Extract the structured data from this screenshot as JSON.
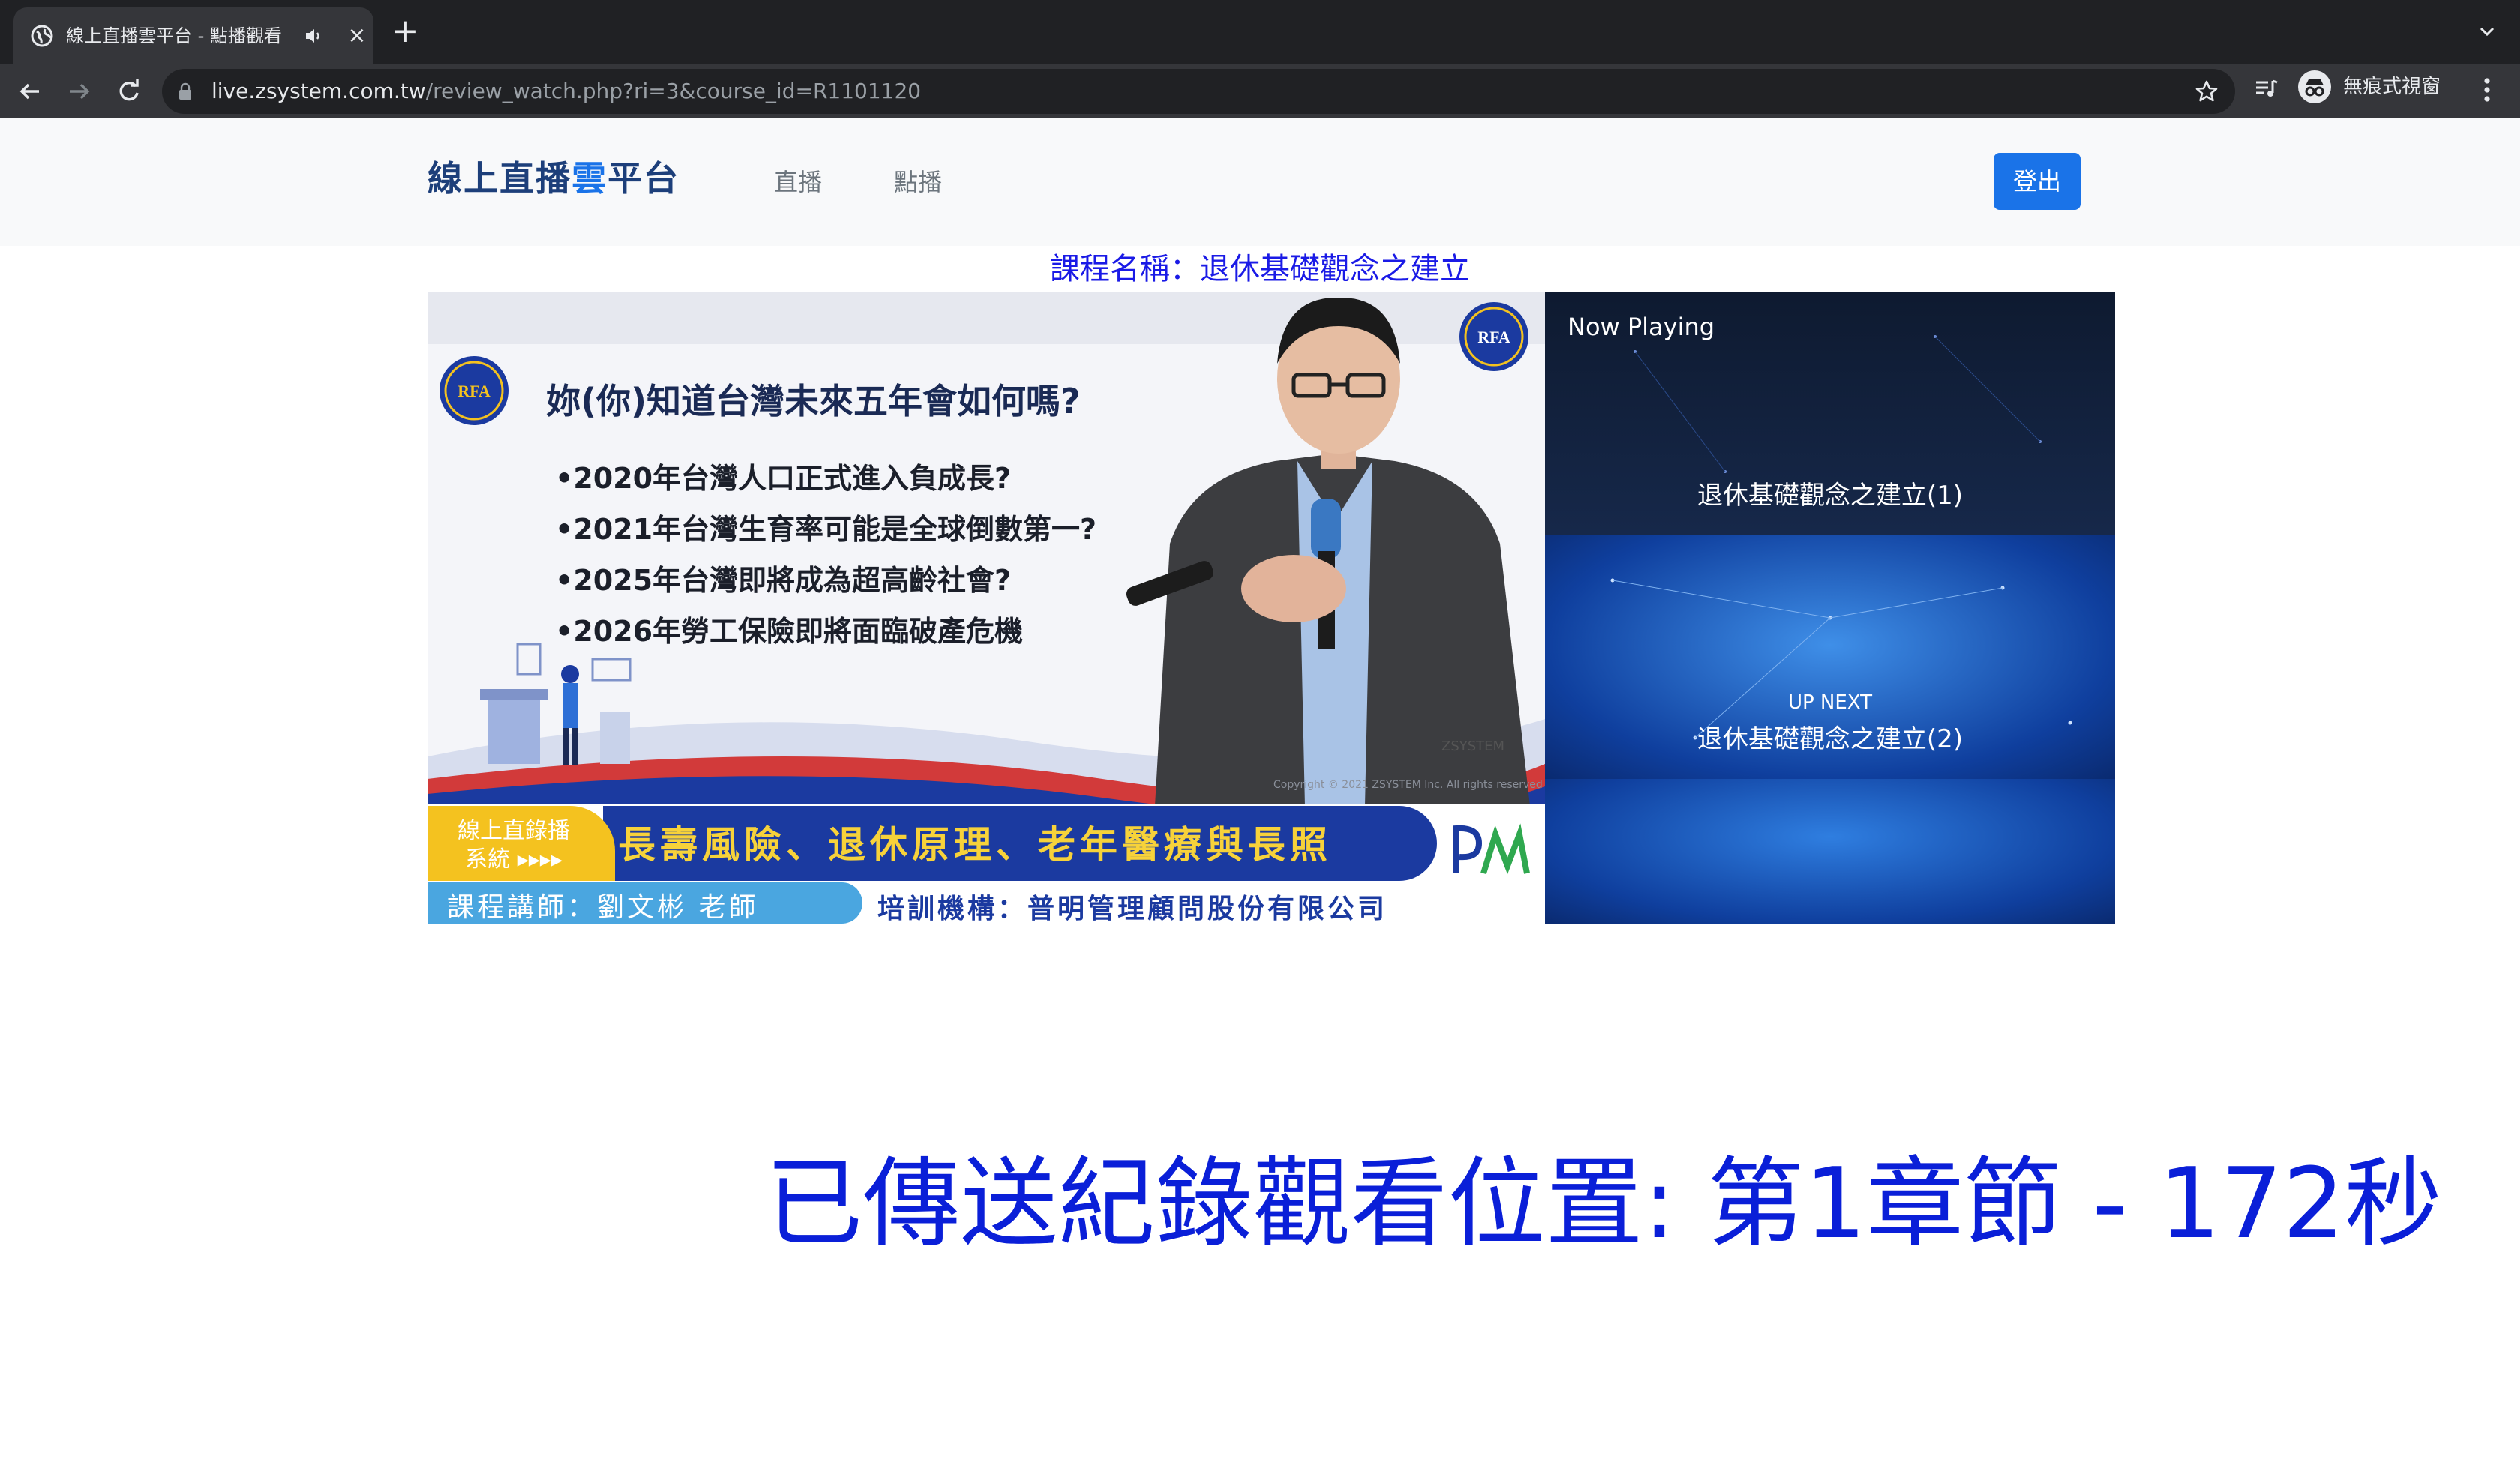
{
  "browser": {
    "tab_title": "線上直播雲平台 - 點播觀看",
    "new_tab": "+",
    "tab_close": "×",
    "url_host": "live.zsystem.com.tw",
    "url_path": "/review_watch.php?ri=3&course_id=R1101120",
    "profile_label": "無痕式視窗"
  },
  "navbar": {
    "brand_part1": "線上直播",
    "brand_accent": "雲",
    "brand_part2": "平台",
    "links": [
      "直播",
      "點播"
    ],
    "logout_label": "登出"
  },
  "course": {
    "title": "課程名稱：退休基礎觀念之建立"
  },
  "video": {
    "slide_heading": "妳(你)知道台灣未來五年會如何嗎?",
    "bullets": [
      "•2020年台灣人口正式進入負成長?",
      "•2021年台灣生育率可能是全球倒數第一?",
      "•2025年台灣即將成為超高齡社會?",
      "•2026年勞工保險即將面臨破產危機"
    ],
    "logo_text": "RFA",
    "watermark": "ZSYSTEM",
    "copyright": "Copyright © 2021 ZSYSTEM Inc. All rights reserved",
    "lower_third": {
      "badge_line1": "線上直錄播",
      "badge_line2": "系統 ▸▸▸▸",
      "headline": "長壽風險、退休原理、老年醫療與長照",
      "lecturer": "課程講師：劉文彬 老師",
      "organization": "培訓機構：普明管理顧問股份有限公司"
    }
  },
  "playlist": {
    "now_playing_label": "Now Playing",
    "up_next_label": "UP NEXT",
    "items": [
      {
        "title": "退休基礎觀念之建立(1)"
      },
      {
        "title": "退休基礎觀念之建立(2)"
      },
      {
        "title": ""
      }
    ]
  },
  "status": {
    "message": "已傳送紀錄觀看位置: 第1章節 - 172秒"
  },
  "colors": {
    "brand_dark": "#1d3f7a",
    "brand_accent": "#1a73e8",
    "logout_button": "#1a73e8",
    "status_text": "#0a1fd8",
    "course_title": "#1a1ae6"
  }
}
